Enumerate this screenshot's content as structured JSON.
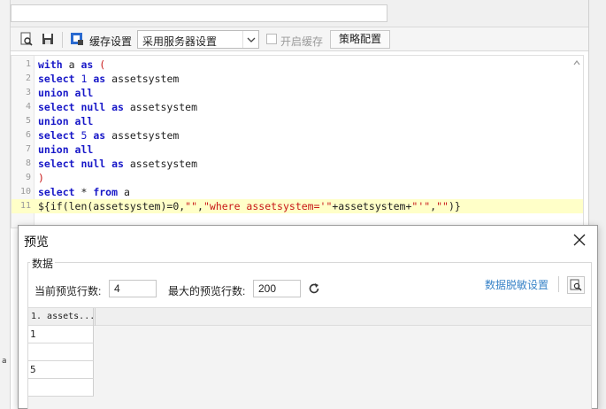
{
  "toolbar": {
    "cache_settings_label": "缓存设置",
    "cache_mode_value": "采用服务器设置",
    "enable_cache_label": "开启缓存",
    "enable_cache_checked": false,
    "strategy_button_label": "策略配置"
  },
  "editor": {
    "line_numbers": [
      "1",
      "2",
      "3",
      "4",
      "5",
      "6",
      "7",
      "8",
      "9",
      "10",
      "11"
    ],
    "highlighted_line": 11
  },
  "dialog": {
    "title": "预览",
    "group_label": "数据",
    "current_rows_label": "当前预览行数:",
    "current_rows_value": "4",
    "max_rows_label": "最大的预览行数:",
    "max_rows_value": "200",
    "masking_link": "数据脱敏设置",
    "grid": {
      "columns": [
        "1. assets..."
      ],
      "rows": [
        "1",
        "",
        "5",
        ""
      ]
    }
  },
  "side_mark": "a"
}
